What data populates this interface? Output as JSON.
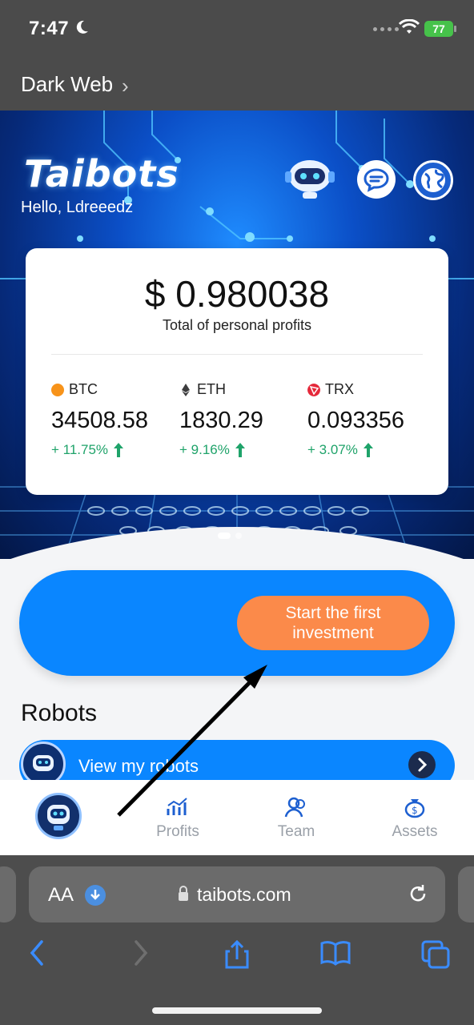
{
  "status_bar": {
    "time": "7:47",
    "battery": "77"
  },
  "browser_back": {
    "label": "Dark Web"
  },
  "header": {
    "logo": "Taibots",
    "greeting": "Hello,  Ldreeedz"
  },
  "profit_card": {
    "amount": "$ 0.980038",
    "label": "Total of personal profits",
    "coins": [
      {
        "symbol": "BTC",
        "price": "34508.58",
        "change": "+ 11.75%",
        "color": "#f7931a"
      },
      {
        "symbol": "ETH",
        "price": "1830.29",
        "change": "+ 9.16%",
        "color": "#3c3c3d"
      },
      {
        "symbol": "TRX",
        "price": "0.093356",
        "change": "+ 3.07%",
        "color": "#e5283a"
      }
    ]
  },
  "invest": {
    "line1": "Start the first",
    "line2": "investment"
  },
  "robots": {
    "title": "Robots",
    "view_label": "View my robots"
  },
  "tabbar": {
    "profits": "Profits",
    "team": "Team",
    "assets": "Assets"
  },
  "safari": {
    "aa": "AA",
    "url": "taibots.com"
  },
  "colors": {
    "primary_blue": "#0a86ff",
    "orange": "#fb8a4a",
    "up_green": "#1fa36a"
  }
}
